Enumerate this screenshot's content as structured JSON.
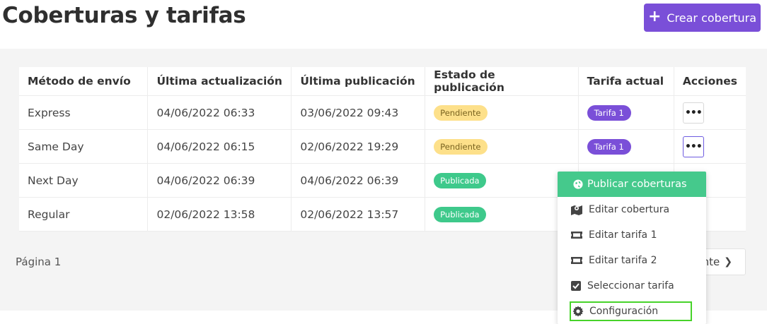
{
  "header": {
    "title": "Coberturas y tarifas",
    "create_label": "Crear cobertura"
  },
  "table": {
    "columns": [
      "Método de envío",
      "Última actualización",
      "Última publicación",
      "Estado de publicación",
      "Tarifa actual",
      "Acciones"
    ],
    "rows": [
      {
        "metodo": "Express",
        "ultima_actualizacion": "04/06/2022 06:33",
        "ultima_publicacion": "03/06/2022 09:43",
        "estado": "Pendiente",
        "tarifa": "Tarifa 1"
      },
      {
        "metodo": "Same Day",
        "ultima_actualizacion": "04/06/2022 06:15",
        "ultima_publicacion": "02/06/2022 19:29",
        "estado": "Pendiente",
        "tarifa": "Tarifa 1"
      },
      {
        "metodo": "Next Day",
        "ultima_actualizacion": "04/06/2022 06:39",
        "ultima_publicacion": "04/06/2022 06:39",
        "estado": "Publicada",
        "tarifa": ""
      },
      {
        "metodo": "Regular",
        "ultima_actualizacion": "02/06/2022 13:58",
        "ultima_publicacion": "02/06/2022 13:57",
        "estado": "Publicada",
        "tarifa": ""
      }
    ],
    "actions_glyph": "•••"
  },
  "pagination": {
    "page_label": "Página 1",
    "next_label": "nte"
  },
  "dropdown": {
    "header_label": "Publicar coberturas",
    "items": [
      {
        "label": "Editar cobertura",
        "icon": "map-icon"
      },
      {
        "label": "Editar tarifa 1",
        "icon": "ticket-icon"
      },
      {
        "label": "Editar tarifa 2",
        "icon": "ticket-icon"
      },
      {
        "label": "Seleccionar tarifa",
        "icon": "checkbox-icon"
      },
      {
        "label": "Configuración",
        "icon": "gear-icon"
      }
    ]
  },
  "colors": {
    "accent_purple": "#7a4fd8",
    "publish_green": "#45c98c",
    "pending_yellow": "#fde08a",
    "highlight_green": "#47d32a"
  }
}
